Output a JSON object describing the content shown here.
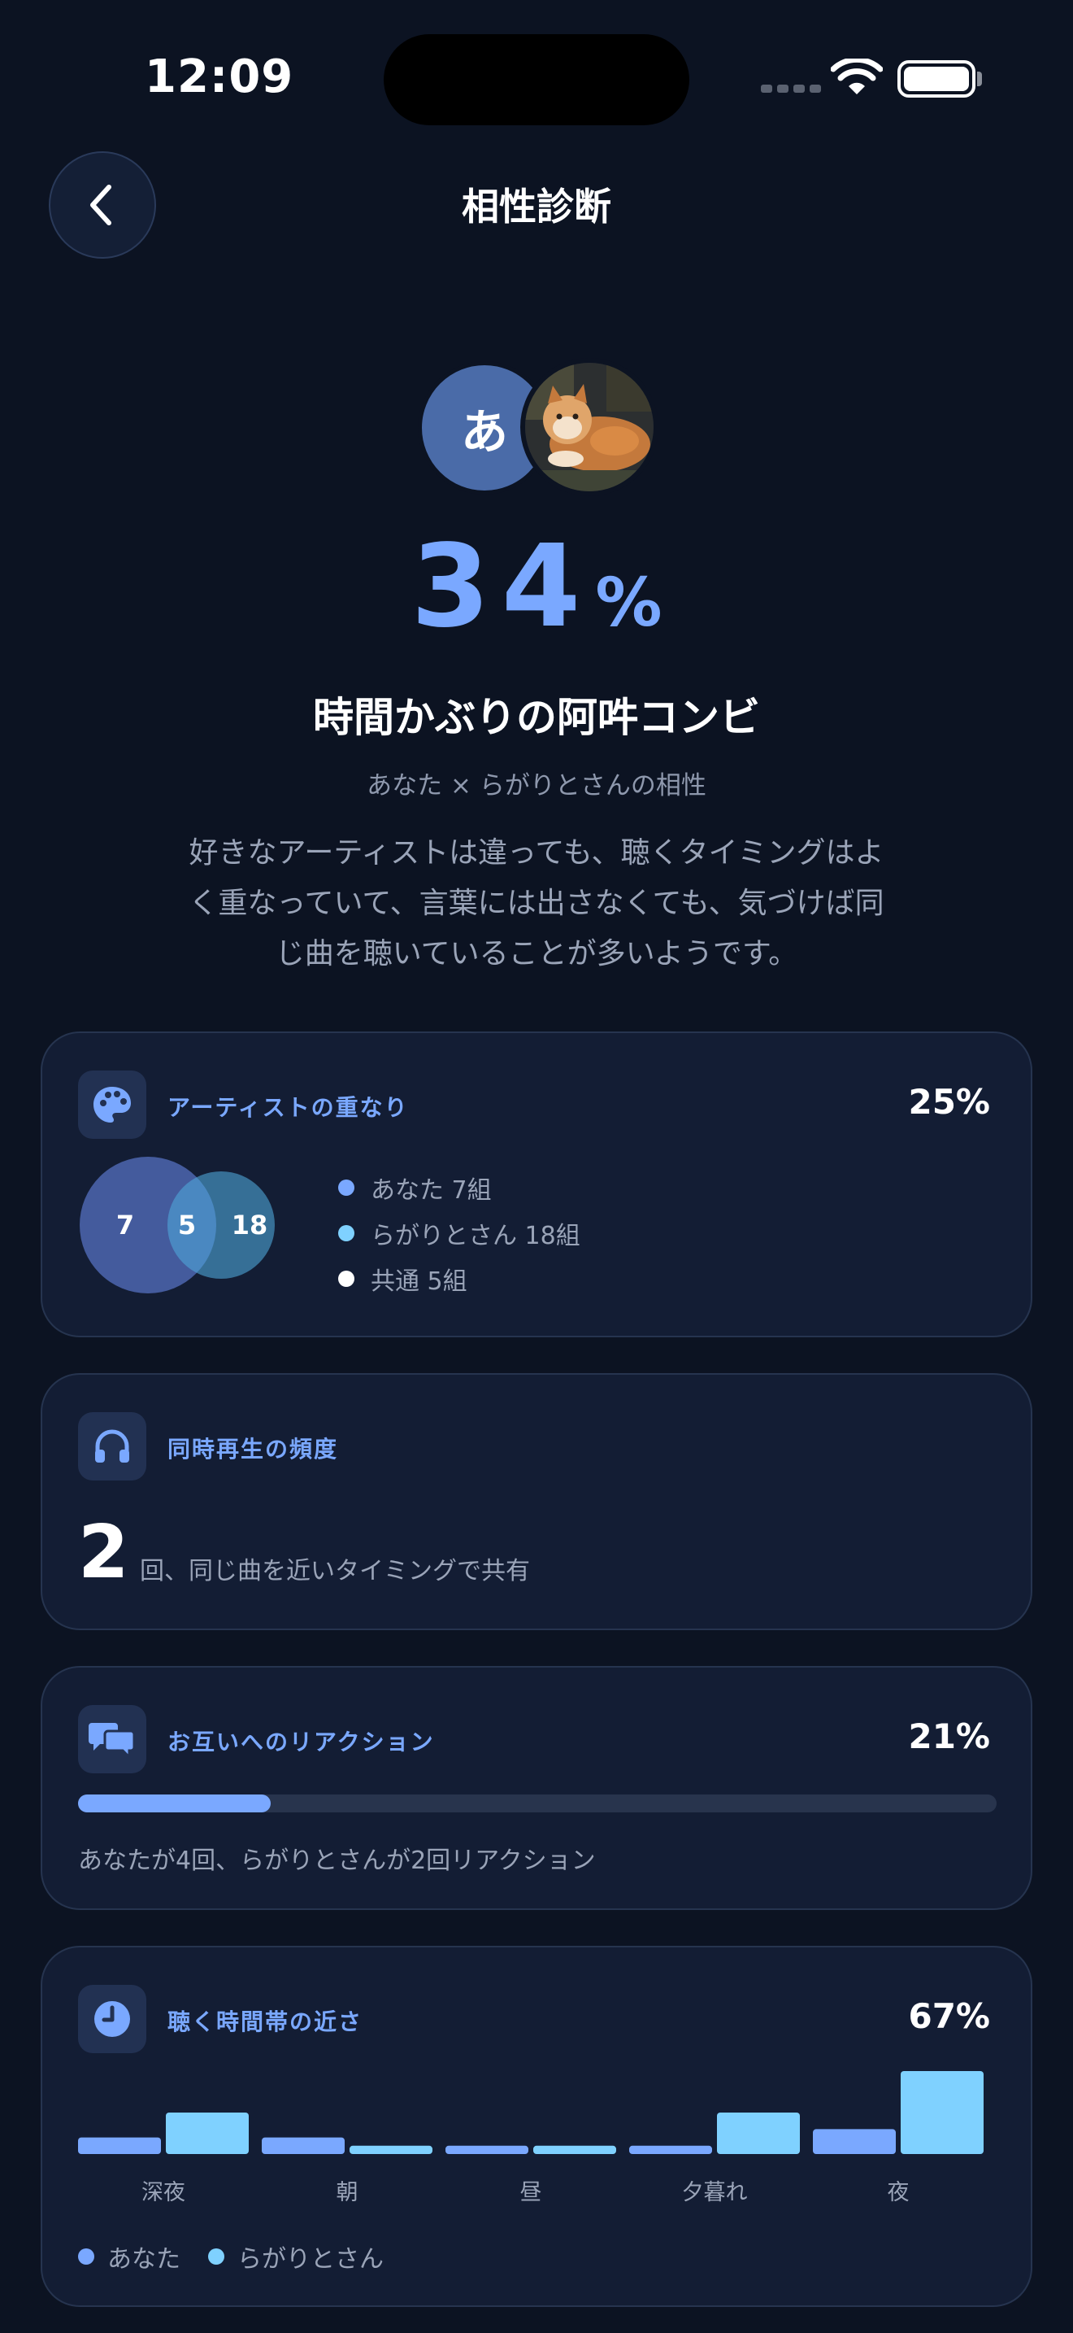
{
  "status_bar": {
    "time": "12:09"
  },
  "header": {
    "title": "相性診断"
  },
  "avatars": {
    "user_initial": "あ"
  },
  "result": {
    "score": "34",
    "score_unit": "%",
    "title": "時間かぶりの阿吽コンビ",
    "subtitle": "あなた × らがりとさんの相性",
    "description": "好きなアーティストは違っても、聴くタイミングはよく重なっていて、言葉には出さなくても、気づけば同じ曲を聴いていることが多いようです。"
  },
  "colors": {
    "accent": "#7aa8ff",
    "you": "#7aa8ff",
    "partner": "#7fd1ff",
    "common": "#ffffff",
    "card_bg": "#131d34",
    "page_bg": "#0c1322"
  },
  "cards": {
    "artists": {
      "icon": "palette-icon",
      "label": "アーティストの重なり",
      "value": "25%",
      "venn": {
        "you_only": "7",
        "common": "5",
        "partner_only": "18"
      },
      "legend": [
        {
          "label": "あなた 7組",
          "color": "#7aa8ff"
        },
        {
          "label": "らがりとさん 18組",
          "color": "#7fd1ff"
        },
        {
          "label": "共通 5組",
          "color": "#ffffff"
        }
      ]
    },
    "frequency": {
      "icon": "headphones-icon",
      "label": "同時再生の頻度",
      "count": "2",
      "text": "回、同じ曲を近いタイミングで共有"
    },
    "reactions": {
      "icon": "chat-bubbles-icon",
      "label": "お互いへのリアクション",
      "value": "21%",
      "progress": 0.21,
      "text": "あなたが4回、らがりとさんが2回リアクション"
    },
    "time": {
      "icon": "clock-icon",
      "label": "聴く時間帯の近さ",
      "value": "67%",
      "legend": [
        {
          "label": "あなた",
          "color": "#7aa8ff"
        },
        {
          "label": "らがりとさん",
          "color": "#7fd1ff"
        }
      ]
    }
  },
  "chart_data": {
    "type": "bar",
    "categories": [
      "深夜",
      "朝",
      "昼",
      "夕暮れ",
      "夜"
    ],
    "series": [
      {
        "name": "あなた",
        "values": [
          2,
          2,
          1,
          1,
          3
        ]
      },
      {
        "name": "らがりとさん",
        "values": [
          5,
          1,
          1,
          5,
          10
        ]
      }
    ],
    "ylim": [
      0,
      10
    ]
  }
}
